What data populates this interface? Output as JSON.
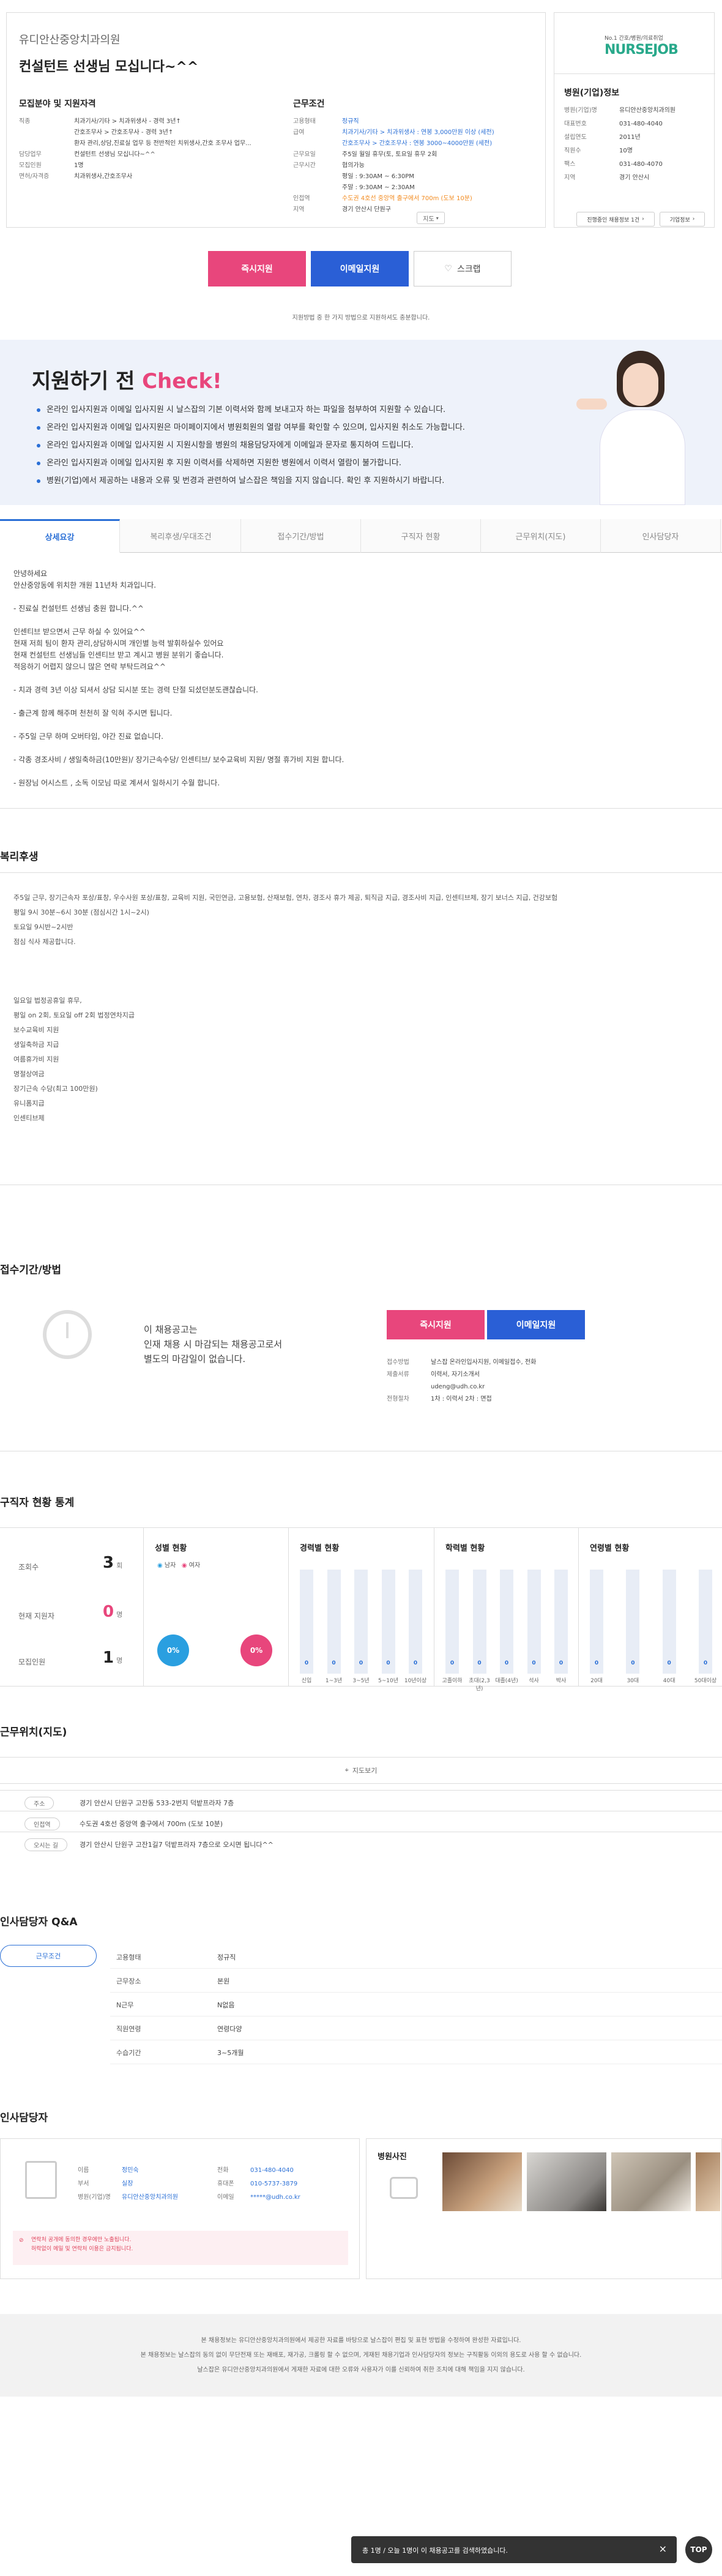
{
  "job": {
    "company": "유디안산중앙치과의원",
    "title": "컨설턴트 선생님 모십니다~^^",
    "req_title": "모집분야 및 지원자격",
    "req": [
      {
        "k": "직종",
        "v": "치과기사/기타 > 치과위생사 - 경력 3년↑"
      },
      {
        "k": "",
        "v": "간호조무사 > 간호조무사 - 경력 3년↑"
      },
      {
        "k": "",
        "v": "환자 관리,상담,진료실 업무 등 전반적인 치위생사,간호 조무사 업무..."
      },
      {
        "k": "담당업무",
        "v": "컨설턴트 선생님 모십니다~^^"
      },
      {
        "k": "모집인원",
        "v": "1명"
      },
      {
        "k": "면허/자격증",
        "v": "치과위생사,간호조무사"
      }
    ],
    "cond_title": "근무조건",
    "cond": [
      {
        "k": "고용형태",
        "v": "정규직"
      },
      {
        "k": "급여",
        "v": "치과기사/기타 > 치과위생사 : 연봉 3,000만원 이상 (세전)"
      },
      {
        "k": "",
        "v": "간호조무사 > 간호조무사 : 연봉 3000~4000만원 (세전)"
      },
      {
        "k": "근무요일",
        "v": "주5일 월일 휴무(토, 토요일 휴무 2회"
      },
      {
        "k": "근무시간",
        "v": "협의가능"
      },
      {
        "k": "",
        "v": "평일 : 9:30AM ~ 6:30PM"
      },
      {
        "k": "",
        "v": "주말 : 9:30AM ~ 2:30AM"
      },
      {
        "k": "인접역",
        "v": "수도권 4호선 중앙역 출구에서 700m (도보 10분)"
      },
      {
        "k": "지역",
        "v": "경기 안산시 단원구"
      }
    ],
    "map_btn": "지도"
  },
  "side": {
    "logo_small": "No.1 간호/병원/의료취업",
    "logo": "NURSEJOB",
    "title": "병원(기업)정보",
    "rows": [
      {
        "k": "병원(기업)명",
        "v": "유디안산중앙치과의원"
      },
      {
        "k": "대표번호",
        "v": "031-480-4040"
      },
      {
        "k": "설립연도",
        "v": "2011년"
      },
      {
        "k": "직원수",
        "v": "10명"
      },
      {
        "k": "팩스",
        "v": "031-480-4070"
      },
      {
        "k": "지역",
        "v": "경기 안산시"
      }
    ],
    "btn1": "진행중인 채용정보 1건",
    "btn2": "기업정보"
  },
  "apply": {
    "quick": "즉시지원",
    "email": "이메일지원",
    "scrap": "스크랩",
    "note": "지원방법 중 한 가지 방법으로 지원하셔도 충분합니다."
  },
  "check": {
    "title_a": "지원하기 전",
    "title_b": "Check!",
    "items": [
      "온라인 입사지원과 이메일 입사지원 시 날스잡의 기본 이력서와 함께 보내고자 하는 파일을 첨부하여 지원할 수 있습니다.",
      "온라인 입사지원과 이메일 입사지원은 마이페이지에서 병원회원의 열람 여부를 확인할 수 있으며, 입사지원 취소도 가능합니다.",
      "온라인 입사지원과 이메일 입사지원 시 지원시항을 병원의 채용담당자에게 이메일과 문자로 통지하여 드립니다.",
      "온라인 입사지원과 이메일 입사지원 후 지원 이력서를 삭제하면 지원한 병원에서 이력서 열람이 불가합니다.",
      "병원(기업)에서 제공하는 내용과 오류 및 번경과 관련하여 날스잡은 책임을 지지 않습니다. 확인 후 지원하시기 바랍니다."
    ]
  },
  "tabs": [
    "상세요강",
    "복리후생/우대조건",
    "접수기간/방법",
    "구직자 현황",
    "근무위치(지도)",
    "인사담당자"
  ],
  "summary": [
    "안녕하세요",
    "안산중앙동에 위치한 개원 11년차 치과입니다.",
    "",
    "- 진료실 컨설턴트 선생님 충원 합니다.^^",
    "",
    "인센티브 받으면서 근무 하실 수 있어요^^",
    "현재 저희 팀이 환자 관리,상담하시며 개인별 능력 발휘하실수 있어요",
    "현재 컨설턴트 선생님들 인센티브 받고 계시고 병원 분위기 좋습니다.",
    "적응하기 어렵지 않으니 많은 연락 부탁드려요^^",
    "",
    "- 치과 경력 3년 이상 되셔서 상담 되시분 또는 경력 단절 되셨던분도괜찮습니다.",
    "",
    "- 출근계 함께 해주며 천천히 잘 익혀 주시면 됩니다.",
    "",
    "- 주5일 근무 하며 오버타임, 야간 진료 없습니다.",
    "",
    "- 각종 경조사비 / 생일축하금(10만원)/ 장기근속수당/ 인센티브/ 보수교육비 지원/ 명절 휴가비 지원 합니다.",
    "",
    "- 원장님 어시스트 , 소독 이모님 따로 계셔서 일하시기 수월 합니다."
  ],
  "benefits": {
    "title": "복리후생",
    "lines": [
      "주5일 근무, 장기근속자 포상/표창, 우수사원 포상/표창, 교육비 지원, 국민연금, 고용보험, 산재보험, 연차, 경조사 휴가 제공, 퇴직금 지급, 경조사비 지급, 인센티브제, 장기 보너스 지급, 건강보험",
      "평일 9시 30분~6시 30분 (점심시간 1시~2시)",
      "토요일 9시반~2시반",
      "점심 식사 제공합니다.",
      "",
      "",
      "",
      "일요일 법정공휴일 휴무,",
      "평일 on 2회, 토요일 off 2회 법정연차지급",
      "보수교육비 지원",
      "생일축하금 지급",
      "여름휴가비 지원",
      "명절상여금",
      "장기근속 수당(최고 100만원)",
      "유니폼지급",
      "인센티브제"
    ]
  },
  "reception": {
    "title": "접수기간/방법",
    "text": [
      "이 채용공고는",
      "인재 채용 시 마감되는 채용공고로서",
      "별도의 마감일이 없습니다."
    ],
    "quick": "즉시지원",
    "email": "이메일지원",
    "rows": [
      {
        "k": "접수방법",
        "v": "날스잡 온라인입사지원, 이메일접수, 전화"
      },
      {
        "k": "제출서류",
        "v": "이력서, 자기소개서"
      },
      {
        "k": "",
        "v": "udeng@udh.co.kr"
      },
      {
        "k": "전형절차",
        "v": "1차 : 이력서   2차 : 면접"
      }
    ]
  },
  "stats": {
    "title": "구직자 현황 통계",
    "views_k": "조회수",
    "views_v": "3",
    "views_u": "회",
    "applicants_k": "현재 지원자",
    "applicants_v": "0",
    "applicants_u": "명",
    "hiring_k": "모집인원",
    "hiring_v": "1",
    "hiring_u": "명",
    "gender_title": "성별 현황",
    "male": "남자",
    "female": "여자",
    "male_pct": "0%",
    "female_pct": "0%",
    "career_title": "경력별 현황",
    "career": [
      {
        "l": "신입",
        "v": "0"
      },
      {
        "l": "1~3년",
        "v": "0"
      },
      {
        "l": "3~5년",
        "v": "0"
      },
      {
        "l": "5~10년",
        "v": "0"
      },
      {
        "l": "10년이상",
        "v": "0"
      }
    ],
    "edu_title": "학력별 현황",
    "edu": [
      {
        "l": "고졸이하",
        "v": "0"
      },
      {
        "l": "초대(2,3년)",
        "v": "0"
      },
      {
        "l": "대졸(4년)",
        "v": "0"
      },
      {
        "l": "석사",
        "v": "0"
      },
      {
        "l": "박사",
        "v": "0"
      }
    ],
    "age_title": "연령별 현황",
    "age": [
      {
        "l": "20대",
        "v": "0"
      },
      {
        "l": "30대",
        "v": "0"
      },
      {
        "l": "40대",
        "v": "0"
      },
      {
        "l": "50대이상",
        "v": "0"
      }
    ]
  },
  "map": {
    "title": "근무위치(지도)",
    "btn": "지도보기",
    "rows": [
      {
        "k": "주소",
        "v": "경기 안산시 단원구 고잔동 533-2번지 덕밭프라자 7층"
      },
      {
        "k": "인접역",
        "v": "수도권 4호선 중앙역 출구에서 700m (도보 10분)"
      },
      {
        "k": "오시는 길",
        "v": "경기 안산시 단원구 고잔1길7 덕밭프라자 7층으로 오시면 됩니다^^"
      }
    ]
  },
  "qa": {
    "title": "인사담당자 Q&A",
    "tab": "근무조건",
    "rows": [
      {
        "k": "고용형태",
        "v": "정규직"
      },
      {
        "k": "근무장소",
        "v": "본원"
      },
      {
        "k": "N근무",
        "v": "N없음"
      },
      {
        "k": "직원연령",
        "v": "연령다양"
      },
      {
        "k": "수습기간",
        "v": "3~5개월"
      }
    ]
  },
  "hr": {
    "title": "인사담당자",
    "rows_l": [
      {
        "k": "이름",
        "v": "정민숙"
      },
      {
        "k": "부서",
        "v": "실장"
      },
      {
        "k": "병원(기업)명",
        "v": "유디안산중앙치과의원"
      }
    ],
    "rows_r": [
      {
        "k": "전화",
        "v": "031-480-4040"
      },
      {
        "k": "휴대폰",
        "v": "010-5737-3879"
      },
      {
        "k": "이메일",
        "v": "*****@udh.co.kr"
      }
    ],
    "warn1": "연락처 공개에 동의한 경우에만 노출됩니다.",
    "warn2": "허락없이 메일 및 연락처 이용은 금지됩니다.",
    "photo_title": "병원사진"
  },
  "footer": {
    "lines": [
      "본 채용정보는 유디안산중앙치과의원에서 제공한 자료를 바탕으로 날스잡이 편집 및 표현 방법을 수정하여 완성한 자료입니다.",
      "본 채용정보는 날스잡의 동의 없이 무단전재 또는 재배포, 재가공, 크롤링 할 수 없으며, 게재된 채용기업과 인사담당자의 정보는 구직활동 이외의 용도로 사용 할 수 없습니다.",
      "날스잡은 유디안산중앙치과의원에서 게재한 자료에 대한 오류와 사용자가 이를 신뢰하여 취한 조치에 대해 책임을 지지 않습니다."
    ]
  },
  "toast": "총 1명 / 오늘 1명이 이 채용공고를 검색하였습니다.",
  "top_btn": "TOP",
  "colors": {
    "blue": "#2a6fd6",
    "pink": "#e8467c",
    "accent_orange": "#f28a1e"
  }
}
